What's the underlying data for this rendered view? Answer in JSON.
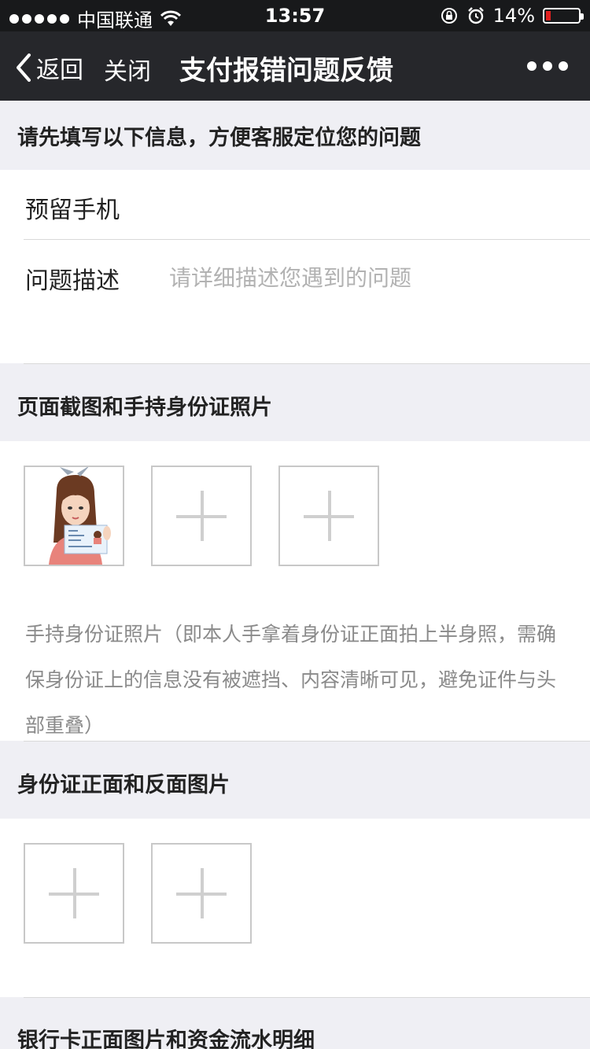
{
  "status_bar": {
    "carrier": "中国联通",
    "time": "13:57",
    "battery": "14%",
    "battery_level": 0.14
  },
  "nav": {
    "back_label": "返回",
    "close_label": "关闭",
    "title": "支付报错问题反馈"
  },
  "sections": {
    "info_header": "请先填写以下信息，方便客服定位您的问题",
    "phone_label": "预留手机",
    "desc_label": "问题描述",
    "desc_placeholder": "请详细描述您遇到的问题",
    "screenshot_header": "页面截图和手持身份证照片",
    "screenshot_hint": "手持身份证照片（即本人手拿着身份证正面拍上半身照，需确保身份证上的信息没有被遮挡、内容清晰可见，避免证件与头部重叠）",
    "id_header": "身份证正面和反面图片",
    "bank_header": "银行卡正面图片和资金流水明细"
  },
  "colors": {
    "status_bg": "#18191b",
    "nav_bg": "#26272b",
    "page_bg": "#efeff4",
    "placeholder": "#b2b2b2",
    "battery_red": "#e02020"
  },
  "icons": [
    "back-chevron-icon",
    "wifi-icon",
    "lock-rotation-icon",
    "alarm-icon",
    "battery-icon",
    "more-dots-icon",
    "plus-icon"
  ]
}
